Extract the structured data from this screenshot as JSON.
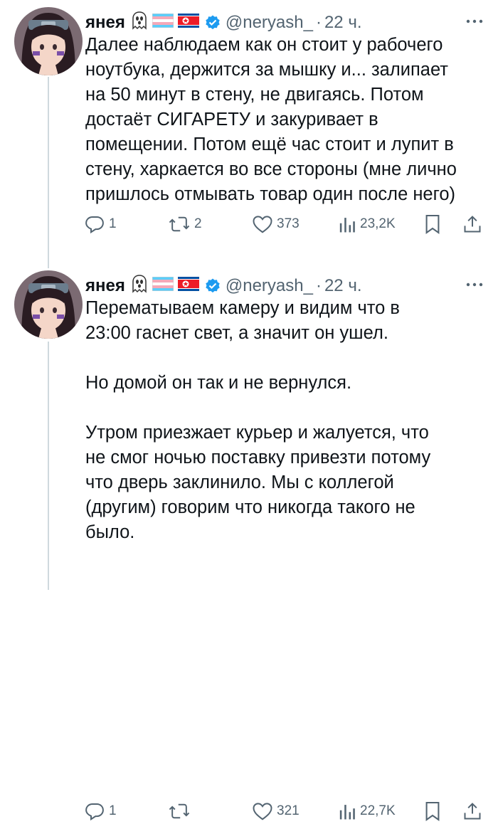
{
  "tweets": [
    {
      "author_name": "янея",
      "handle": "@neryash_",
      "time": "22 ч.",
      "text": "Далее наблюдаем как он стоит у рабочего\nноутбука, держится за мышку и... залипает\nна 50 минут в стену, не двигаясь. Потом\nдостаёт СИГАРЕТУ и закуривает в\nпомещении. Потом ещё час стоит и лупит в\nстену, харкается во все стороны (мне лично\nпришлось отмывать товар один после него)",
      "replies": "1",
      "retweets": "2",
      "likes": "373",
      "views": "23,2K",
      "more_icon": "ellipsis-icon",
      "author_emojis": [
        "ghost-emoji",
        "trans-flag-emoji",
        "north-korea-flag-emoji"
      ]
    },
    {
      "author_name": "янея",
      "handle": "@neryash_",
      "time": "22 ч.",
      "text": "Перематываем камеру и видим что в\n23:00 гаснет свет, а значит он ушел.\n\nНо домой он так и не вернулся.\n\nУтром приезжает курьер и жалуется, что\nне смог ночью поставку привезти потому\nчто дверь заклинило. Мы с коллегой\n(другим) говорим что никогда такого не\nбыло.",
      "replies": "1",
      "retweets": "",
      "likes": "321",
      "views": "22,7K",
      "more_icon": "ellipsis-icon",
      "author_emojis": [
        "ghost-emoji",
        "trans-flag-emoji",
        "north-korea-flag-emoji"
      ]
    }
  ],
  "colors": {
    "text_primary": "#0f1419",
    "text_secondary": "#536471",
    "verified_blue": "#1d9bf0",
    "thread_line": "#cfd9de"
  }
}
